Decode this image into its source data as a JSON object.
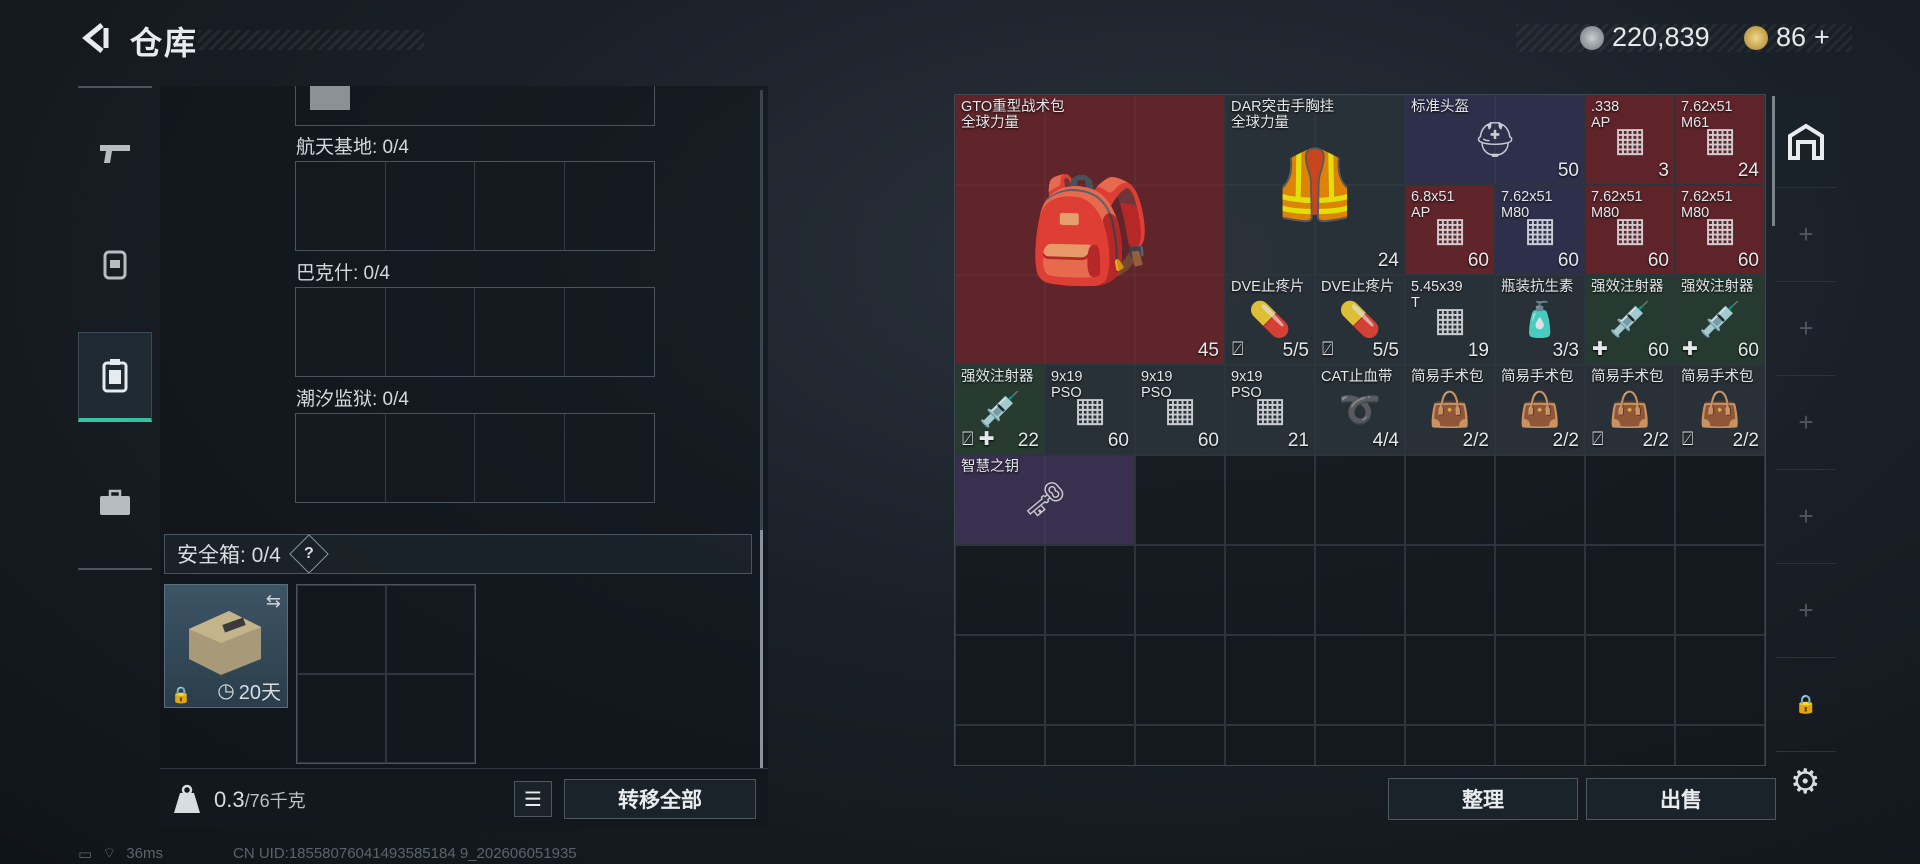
{
  "header": {
    "title": "仓库"
  },
  "currency": {
    "coins": "220,839",
    "premium": "86",
    "premium_plus": "+"
  },
  "left_panel": {
    "raids": [
      {
        "label": "航天基地: 0/4"
      },
      {
        "label": "巴克什: 0/4"
      },
      {
        "label": "潮汐监狱: 0/4"
      }
    ],
    "safe_box": {
      "label": "安全箱: 0/4",
      "help": "?",
      "duration": "20天"
    },
    "weight": {
      "current": "0.3",
      "max": "/76千克"
    },
    "transfer_all": "转移全部"
  },
  "stash": {
    "items": [
      {
        "name": "GTO重型战术包",
        "sub": "全球力量",
        "count": "45",
        "color": "red"
      },
      {
        "name": "DAR突击手胸挂",
        "sub": "全球力量",
        "count": "24",
        "color": "grey"
      },
      {
        "name": "标准头盔",
        "count": "50",
        "color": "blue"
      },
      {
        "name": ".338\nAP",
        "count": "3",
        "color": "red"
      },
      {
        "name": "7.62x51\nM61",
        "count": "24",
        "color": "red"
      },
      {
        "name": "6.8x51\nAP",
        "count": "60",
        "color": "red"
      },
      {
        "name": "7.62x51\nM80",
        "count": "60",
        "color": "blue"
      },
      {
        "name": "7.62x51\nM80",
        "count": "60",
        "color": "red"
      },
      {
        "name": "7.62x51\nM80",
        "count": "60",
        "color": "red"
      },
      {
        "name": "DVE止疼片",
        "count": "5/5",
        "color": "grey"
      },
      {
        "name": "DVE止疼片",
        "count": "5/5",
        "color": "grey"
      },
      {
        "name": "5.45x39\nT",
        "count": "19",
        "color": "grey"
      },
      {
        "name": "瓶装抗生素",
        "count": "3/3",
        "color": "grey"
      },
      {
        "name": "强效注射器",
        "count": "60",
        "color": "green"
      },
      {
        "name": "强效注射器",
        "count": "60",
        "color": "green"
      },
      {
        "name": "强效注射器",
        "count": "22",
        "color": "green"
      },
      {
        "name": "9x19\nPSO",
        "count": "60",
        "color": "grey"
      },
      {
        "name": "9x19\nPSO",
        "count": "60",
        "color": "grey"
      },
      {
        "name": "9x19\nPSO",
        "count": "21",
        "color": "grey"
      },
      {
        "name": "CAT止血带",
        "count": "4/4",
        "color": "grey"
      },
      {
        "name": "简易手术包",
        "count": "2/2",
        "color": "grey"
      },
      {
        "name": "简易手术包",
        "count": "2/2",
        "color": "grey"
      },
      {
        "name": "简易手术包",
        "count": "2/2",
        "color": "grey"
      },
      {
        "name": "简易手术包",
        "count": "2/2",
        "color": "grey"
      },
      {
        "name": "智慧之钥",
        "count": "",
        "color": "purple"
      }
    ],
    "sort_label": "整理",
    "sell_label": "出售"
  },
  "status": {
    "ping": "36ms",
    "uid": "CN UID:18558076041493585184 9_202606051935"
  }
}
